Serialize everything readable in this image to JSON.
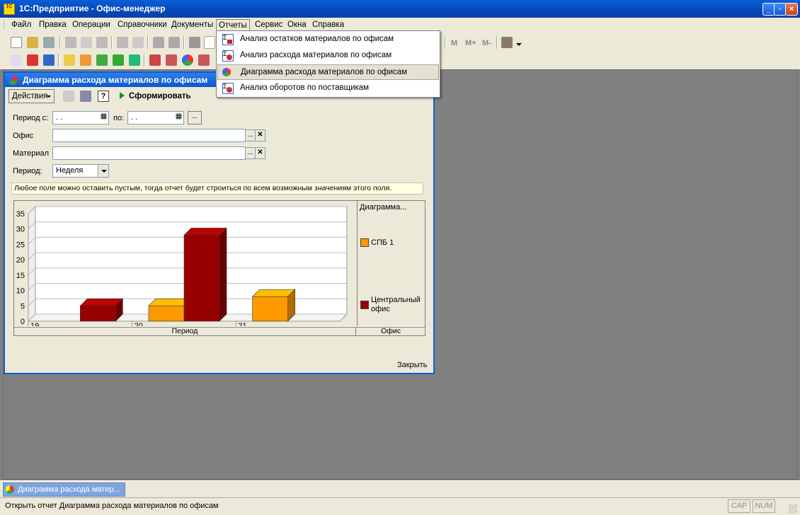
{
  "window": {
    "title": "1С:Предприятие - Офис-менеджер",
    "icon_text": "1С"
  },
  "menubar": [
    "Файл",
    "Правка",
    "Операции",
    "Справочники",
    "Документы",
    "Отчеты",
    "Сервис",
    "Окна",
    "Справка"
  ],
  "reports_menu": {
    "items": [
      {
        "label": "Анализ остатков материалов по офисам",
        "icon": "report-sigma-icon"
      },
      {
        "label": "Анализ расхода материалов по офисам",
        "icon": "report-sigma-people-icon"
      },
      {
        "label": "Диаграмма расхода материалов по офисам",
        "icon": "pie-chart-icon"
      },
      {
        "label": "Анализ оборотов по поставщикам",
        "icon": "report-sigma-people-icon"
      }
    ]
  },
  "toolbar": {
    "memory_labels": [
      "M",
      "M+",
      "M-"
    ]
  },
  "report_window": {
    "title": "Диаграмма расхода материалов по офисам",
    "actions_label": "Действия",
    "help_label": "?",
    "generate_label": "Сформировать",
    "period_from_label": "Период с:",
    "period_from_value": " .  .",
    "period_to_label": "по:",
    "period_to_value": " .  .",
    "office_label": "Офис",
    "office_value": "",
    "material_label": "Материал",
    "material_value": "",
    "period_label": "Период:",
    "period_value": "Неделя",
    "hint": "Любое поле можно оставить пустым, тогда отчет будет строиться по всем возможным значениям этого поля.",
    "close_label": "Закрыть"
  },
  "chart_data": {
    "type": "bar",
    "title": "Диаграмма...",
    "categories": [
      "19",
      "20",
      "21"
    ],
    "series": [
      {
        "name": "СПБ 1",
        "color": "#ff9900",
        "values": [
          0,
          5,
          8
        ]
      },
      {
        "name": "Центральный офис",
        "color": "#990000",
        "values": [
          5,
          28,
          0
        ]
      }
    ],
    "ylim": [
      0,
      35
    ],
    "yticks": [
      0,
      5,
      10,
      15,
      20,
      25,
      30,
      35
    ],
    "xlabel": "Период",
    "legend_title": "Офис",
    "grid": true
  },
  "mdi_tab": "Диаграмма расхода матер...",
  "status": {
    "message": "Открыть отчет Диаграмма расхода материалов по офисам",
    "indicators": [
      "CAP",
      "NUM"
    ]
  }
}
